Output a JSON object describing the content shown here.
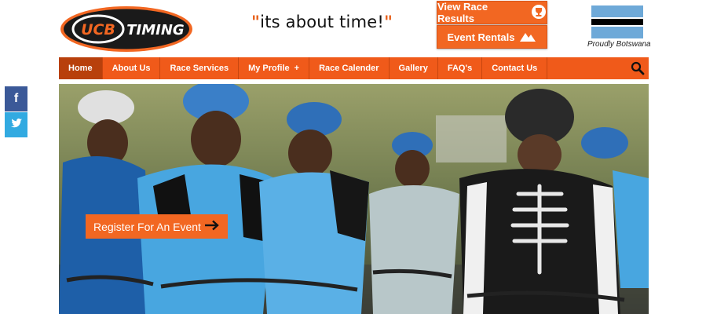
{
  "logo": {
    "brand": "UCB",
    "word": "TIMING"
  },
  "tagline": {
    "open_quote": "\"",
    "text": "its about time!",
    "close_quote": "\""
  },
  "top_buttons": [
    {
      "label": "View Race Results",
      "icon": "trophy-icon"
    },
    {
      "label": "Event Rentals",
      "icon": "mountain-icon"
    }
  ],
  "flag": {
    "caption": "Proudly Botswana",
    "colors": {
      "blue": "#6ea9d8",
      "black": "#000000",
      "white": "#ffffff"
    }
  },
  "nav": {
    "items": [
      "Home",
      "About Us",
      "Race Services",
      "My Profile",
      "Race Calender",
      "Gallery",
      "FAQ's",
      "Contact Us"
    ],
    "profile_plus": "+",
    "active": "Home"
  },
  "social": {
    "facebook": "f",
    "twitter": "twitter-icon"
  },
  "hero": {
    "cta_label": "Register For An Event",
    "cta_icon": "arrow-right-icon"
  },
  "colors": {
    "accent": "#f26722",
    "nav_bg": "#f05a1a",
    "nav_active": "#b8400c"
  }
}
